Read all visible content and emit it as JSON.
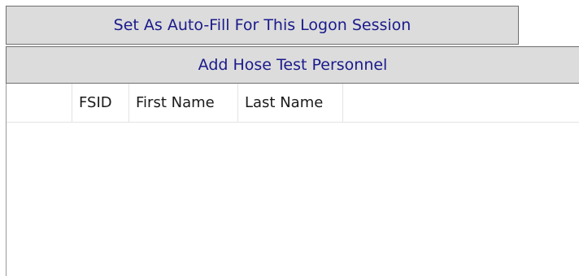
{
  "buttons": {
    "autofill_label": "Set As Auto-Fill For This Logon Session",
    "add_personnel_label": "Add Hose Test Personnel"
  },
  "grid": {
    "columns": [
      "FSID",
      "First Name",
      "Last Name"
    ],
    "rows": []
  },
  "colors": {
    "button_background": "#dcdcdc",
    "button_text": "#1a1a8c",
    "button_border": "#6f6f6f",
    "grid_line": "#e3e3e3"
  }
}
